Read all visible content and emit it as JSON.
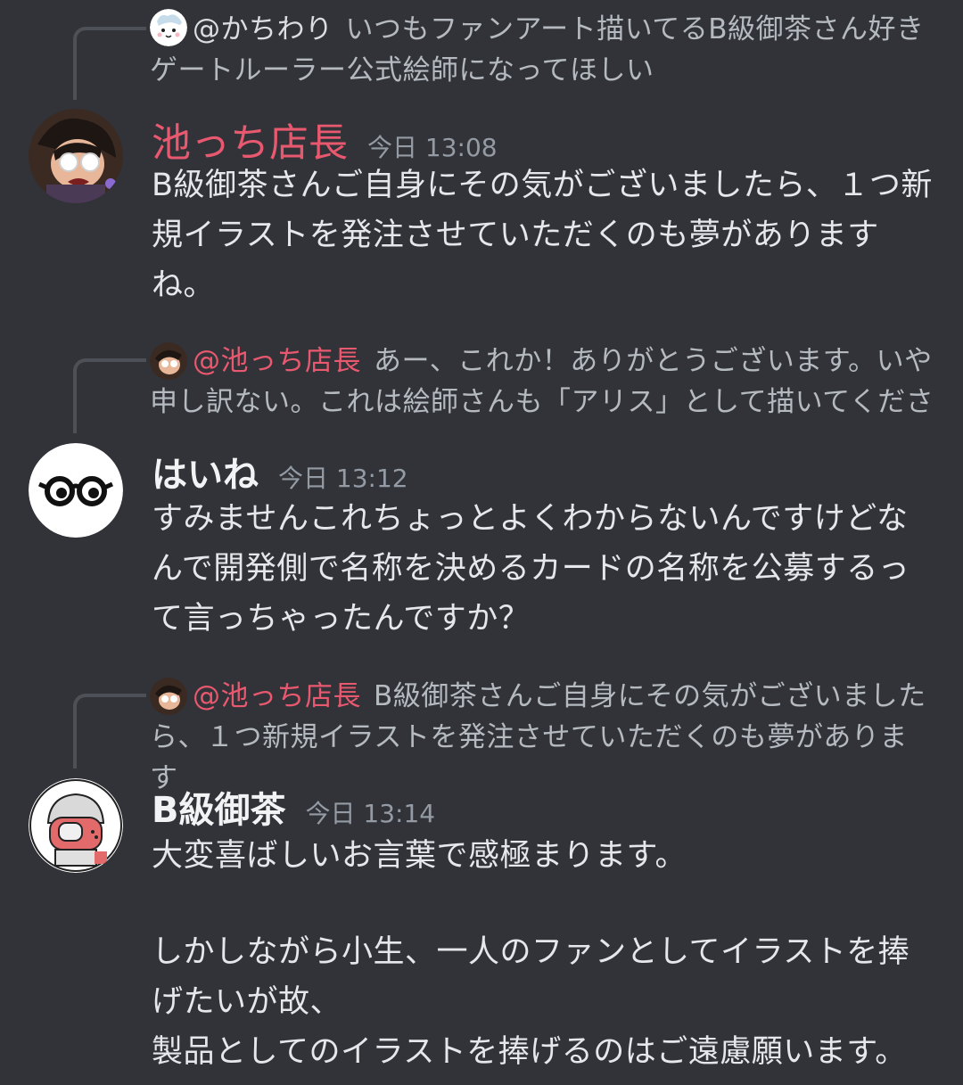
{
  "messages": [
    {
      "reply": {
        "mention": "@かちわり",
        "text": "いつもファンアート描いてるB級御茶さん好きゲートルーラー公式絵師になってほしい"
      },
      "author": "池っち店長",
      "timestamp": "今日 13:08",
      "content": "B級御茶さんご自身にその気がございましたら、１つ新規イラストを発注させていただくのも夢がありますね。"
    },
    {
      "reply": {
        "mention": "@池っち店長",
        "text": "あー、これか！ありがとうございます。いや申し訳ない。これは絵師さんも「アリス」として描いてくださ"
      },
      "author": "はいね",
      "timestamp": "今日 13:12",
      "content": "すみませんこれちょっとよくわからないんですけどなんで開発側で名称を決めるカードの名称を公募するって言っちゃったんですか？"
    },
    {
      "reply": {
        "mention": "@池っち店長",
        "text": "B級御茶さんご自身にその気がございましたら、１つ新規イラストを発注させていただくのも夢があります"
      },
      "author": "B級御茶",
      "timestamp": "今日 13:14",
      "content_lines": [
        "大変喜ばしいお言葉で感極まります。",
        "しかしながら小生、一人のファンとしてイラストを捧げたいが故、",
        "製品としてのイラストを捧げるのはご遠慮願います。"
      ]
    }
  ],
  "colors": {
    "background": "#313338",
    "mention_pink": "#e8586f",
    "reply_line": "#4e5058"
  },
  "icons": [
    "kachiwari-avatar",
    "ikecchi-avatar",
    "haine-glasses-avatar",
    "bkyu-ocha-avatar"
  ]
}
